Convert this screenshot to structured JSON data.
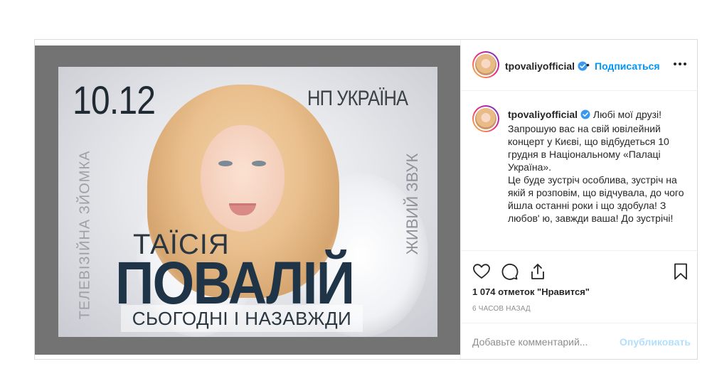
{
  "post": {
    "username": "tpovaliyofficial",
    "follow_label": "Подписаться",
    "dot": "•",
    "caption": "Любі мої друзі! Запрошую вас на свій ювілейний концерт у Києві, що відбудеться 10 грудня в Національному «Палаці Україна».\nЦе буде зустріч особлива, зустріч на якій я розповім, що відчувала, до чого йшла останні роки і що здобула! З любов' ю, завжди ваша! До зустрічі!",
    "likes_text": "1 074 отметок \"Нравится\"",
    "time_ago": "6 ЧАСОВ НАЗАД",
    "comment_placeholder": "Добавьте комментарий...",
    "publish_label": "Опубликовать"
  },
  "poster": {
    "date": "10.12",
    "venue": "НП УКРАЇНА",
    "left_vertical": "ТЕЛЕВІЗІЙНА ЗЙОМКА",
    "right_vertical": "ЖИВИЙ ЗВУК",
    "first_name": "ТАЇСІЯ",
    "last_name": "ПОВАЛІЙ",
    "tagline": "СЬОГОДНІ І НАЗАВЖДИ"
  },
  "colors": {
    "accent": "#0095f6",
    "publish_disabled": "#b2dffc",
    "border": "#dbdbdb",
    "media_frame": "#737373"
  },
  "icons": [
    "verified-badge-icon",
    "more-options-icon",
    "heart-icon",
    "comment-icon",
    "share-icon",
    "bookmark-icon"
  ]
}
